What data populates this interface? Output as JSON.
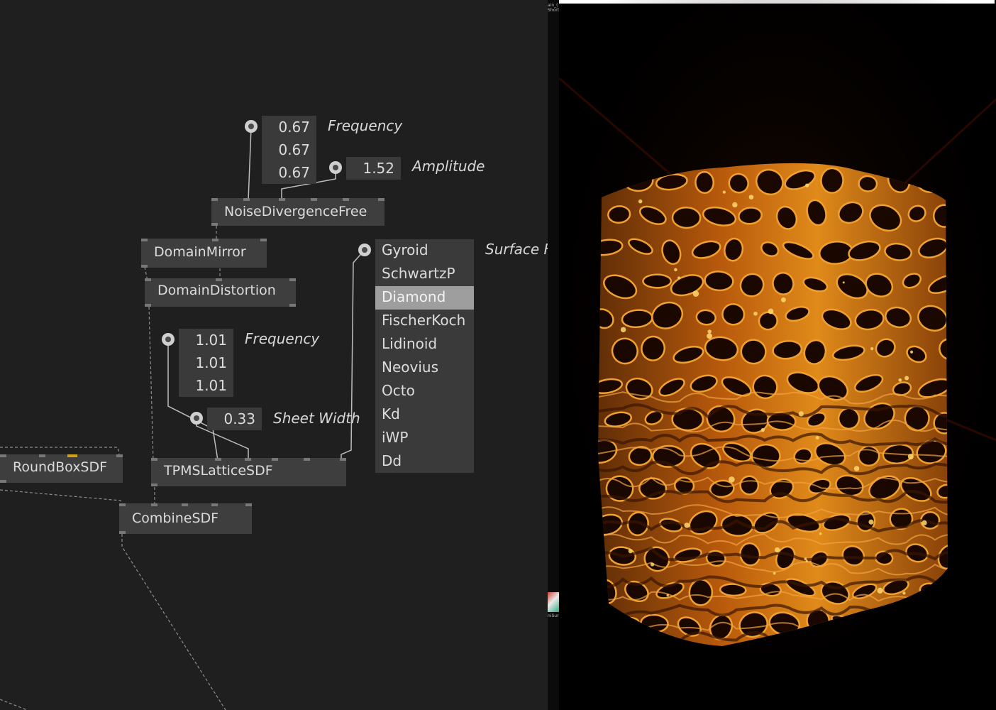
{
  "patch": {
    "noise_frequency": {
      "values": [
        "0.67",
        "0.67",
        "0.67"
      ],
      "label": "Frequency"
    },
    "noise_amplitude": {
      "value": "1.52",
      "label": "Amplitude"
    },
    "lattice_frequency": {
      "values": [
        "1.01",
        "1.01",
        "1.01"
      ],
      "label": "Frequency"
    },
    "sheet_width": {
      "value": "0.33",
      "label": "Sheet Width"
    },
    "surface_label": "Surface F",
    "surface_options": [
      "Gyroid",
      "SchwartzP",
      "Diamond",
      "FischerKoch",
      "Lidinoid",
      "Neovius",
      "Octo",
      "Kd",
      "iWP",
      "Dd"
    ],
    "surface_selected": "Diamond",
    "nodes": {
      "noise": "NoiseDivergenceFree",
      "domain_mirror": "DomainMirror",
      "domain_distortion": "DomainDistortion",
      "roundbox": "RoundBoxSDF",
      "tpms": "TPMSLatticeSDF",
      "combine": "CombineSDF"
    }
  },
  "divider": {
    "label_top": "ain_( Short",
    "label_bottom": "niSur"
  },
  "viewport": {
    "background": "#000000",
    "material_color": "#d9780f",
    "highlight_color": "#ffd870"
  }
}
